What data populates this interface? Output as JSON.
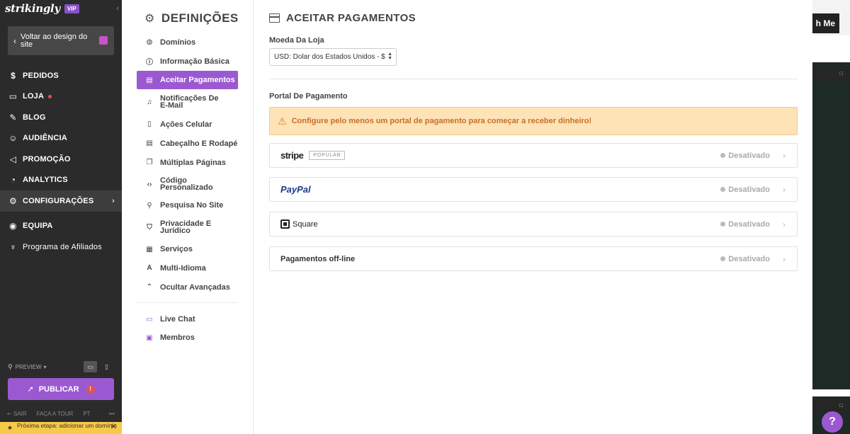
{
  "app": {
    "logo": "strikingly",
    "badge": "VIP"
  },
  "sidebar": {
    "back_label": "Voltar ao design do site",
    "items": [
      {
        "label": "PEDIDOS",
        "icon": "dollar-circle-icon"
      },
      {
        "label": "LOJA",
        "icon": "store-icon",
        "has_dot": true
      },
      {
        "label": "BLOG",
        "icon": "pen-icon"
      },
      {
        "label": "AUDIÊNCIA",
        "icon": "people-icon"
      },
      {
        "label": "PROMOÇÃO",
        "icon": "megaphone-icon"
      },
      {
        "label": "ANALYTICS",
        "icon": "analytics-icon"
      },
      {
        "label": "CONFIGURAÇÕES",
        "icon": "gear-icon",
        "active": true
      },
      {
        "label": "EQUIPA",
        "icon": "team-icon"
      },
      {
        "label": "Programa de Afiliados",
        "icon": "trophy-icon"
      }
    ],
    "preview_label": "PREVIEW",
    "publish_label": "PUBLICAR",
    "publish_alert": "!",
    "footer": {
      "exit": "SAIR",
      "tour": "FAÇA A TOUR",
      "lang": "PT",
      "more": "•••"
    },
    "next_step": "Próxima etapa: adicionar um domínio"
  },
  "background": {
    "button_label": "h Me"
  },
  "settings_nav": {
    "title": "DEFINIÇÕES",
    "items": [
      {
        "label": "Domínios",
        "icon": "globe-icon"
      },
      {
        "label": "Informação Básica",
        "icon": "info-icon"
      },
      {
        "label": "Aceitar Pagamentos",
        "icon": "payment-icon",
        "active": true
      },
      {
        "label": "Notificações De E-Mail",
        "icon": "bell-icon"
      },
      {
        "label": "Ações Celular",
        "icon": "mobile-icon"
      },
      {
        "label": "Cabeçalho E Rodapé",
        "icon": "layout-icon"
      },
      {
        "label": "Múltiplas Páginas",
        "icon": "pages-icon"
      },
      {
        "label": "Código Personalizado",
        "icon": "code-icon"
      },
      {
        "label": "Pesquisa No Site",
        "icon": "search-icon"
      },
      {
        "label": "Privacidade E Jurídico",
        "icon": "shield-icon"
      },
      {
        "label": "Serviços",
        "icon": "grid-icon"
      },
      {
        "label": "Multi-Idioma",
        "icon": "translate-icon"
      },
      {
        "label": "Ocultar Avançadas",
        "icon": "chevron-up-icon"
      }
    ],
    "extras": [
      {
        "label": "Live Chat",
        "icon": "chat-icon"
      },
      {
        "label": "Membros",
        "icon": "member-icon"
      }
    ]
  },
  "content": {
    "title": "ACEITAR PAGAMENTOS",
    "currency_label": "Moeda Da Loja",
    "currency_value": "USD: Dolar dos Estados Unidos - $",
    "portal_label": "Portal De Pagamento",
    "warning": "Configure pelo menos um portal de pagamento para começar a receber dinheiro!",
    "gateways": [
      {
        "name": "stripe",
        "tag": "POPULAR",
        "status": "Desativado"
      },
      {
        "name": "PayPal",
        "status": "Desativado"
      },
      {
        "name": "Square",
        "status": "Desativado"
      },
      {
        "name": "Pagamentos off-line",
        "status": "Desativado"
      }
    ]
  }
}
